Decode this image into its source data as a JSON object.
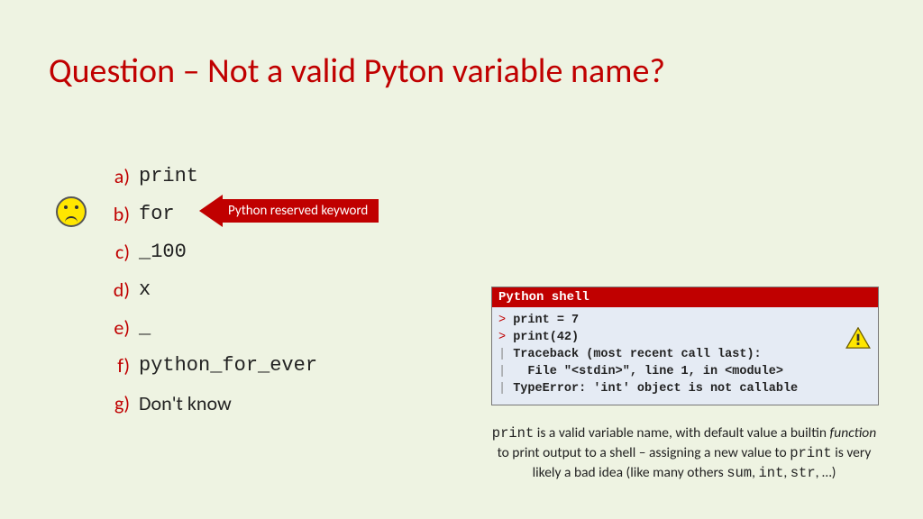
{
  "title": "Question – Not a valid Pyton variable name?",
  "options": [
    {
      "letter": "a)",
      "value": "print",
      "mono": true
    },
    {
      "letter": "b)",
      "value": "for",
      "mono": true
    },
    {
      "letter": "c)",
      "value": "_100",
      "mono": true
    },
    {
      "letter": "d)",
      "value": "x",
      "mono": true
    },
    {
      "letter": "e)",
      "value": "_",
      "mono": true
    },
    {
      "letter": "f)",
      "value": "python_for_ever",
      "mono": true
    },
    {
      "letter": "g)",
      "value": "Don't know",
      "mono": false
    }
  ],
  "callout": "Python reserved keyword",
  "shell": {
    "title": "Python shell",
    "lines": [
      {
        "lead": ">",
        "lead_class": "prompt",
        "text": " print = 7"
      },
      {
        "lead": ">",
        "lead_class": "prompt",
        "text": " print(42)"
      },
      {
        "lead": "|",
        "lead_class": "pipe",
        "text": " Traceback (most recent call last):"
      },
      {
        "lead": "|",
        "lead_class": "pipe",
        "text": "   File \"<stdin>\", line 1, in <module>"
      },
      {
        "lead": "|",
        "lead_class": "pipe",
        "text": " TypeError: 'int' object is not callable"
      }
    ]
  },
  "footnote": {
    "w1": "print",
    "t1": " is a valid variable name, with default value a builtin ",
    "em": "function",
    "t2": " to print output to a shell – assigning a new value to ",
    "w2": "print",
    "t3": " is very likely a bad idea (like many others ",
    "w3": "sum",
    "c1": ", ",
    "w4": "int",
    "c2": ", ",
    "w5": "str",
    "t4": ", …)"
  }
}
